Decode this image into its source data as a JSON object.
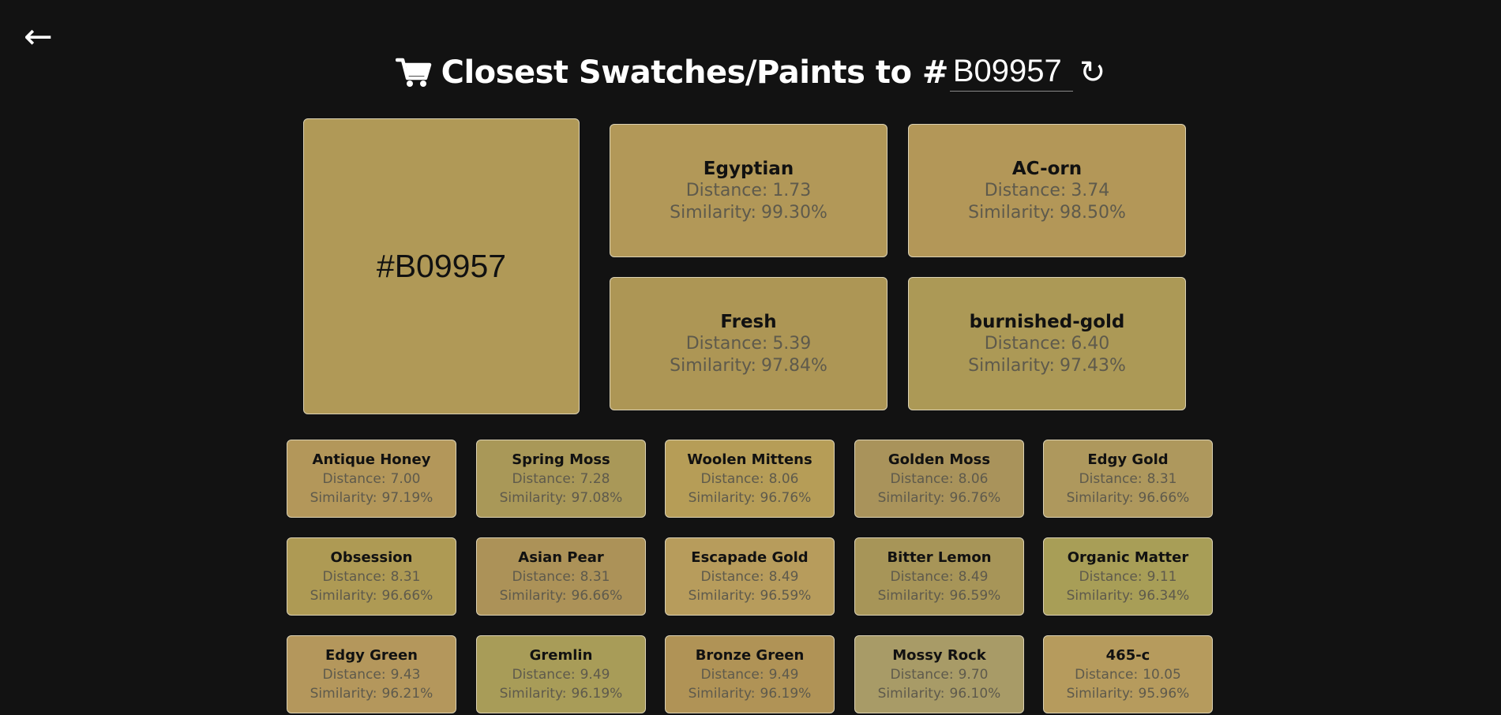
{
  "nav": {
    "back_glyph": "←"
  },
  "header": {
    "cart_icon": "cart-icon",
    "title": "Closest Swatches/Paints to #",
    "hex_value": "B09957",
    "refresh_glyph": "↻"
  },
  "main_swatch": {
    "label": "#B09957",
    "color": "#B09957"
  },
  "labels": {
    "distance": "Distance:",
    "similarity": "Similarity:"
  },
  "top_matches": [
    {
      "name": "Egyptian",
      "distance": "1.73",
      "similarity": "99.30%",
      "color": "#B29858"
    },
    {
      "name": "AC-orn",
      "distance": "3.74",
      "similarity": "98.50%",
      "color": "#B39758"
    },
    {
      "name": "Fresh",
      "distance": "5.39",
      "similarity": "97.84%",
      "color": "#AD9655"
    },
    {
      "name": "burnished-gold",
      "distance": "6.40",
      "similarity": "97.43%",
      "color": "#AC9956"
    }
  ],
  "matches": [
    {
      "name": "Antique Honey",
      "distance": "7.00",
      "similarity": "97.19%",
      "color": "#B3975A"
    },
    {
      "name": "Spring Moss",
      "distance": "7.28",
      "similarity": "97.08%",
      "color": "#A99858"
    },
    {
      "name": "Woolen Mittens",
      "distance": "8.06",
      "similarity": "96.76%",
      "color": "#B69D57"
    },
    {
      "name": "Golden Moss",
      "distance": "8.06",
      "similarity": "96.76%",
      "color": "#A9935B"
    },
    {
      "name": "Edgy Gold",
      "distance": "8.31",
      "similarity": "96.66%",
      "color": "#AE985D"
    },
    {
      "name": "Obsession",
      "distance": "8.31",
      "similarity": "96.66%",
      "color": "#AE9A54"
    },
    {
      "name": "Asian Pear",
      "distance": "8.31",
      "similarity": "96.66%",
      "color": "#AC9258"
    },
    {
      "name": "Escapade Gold",
      "distance": "8.49",
      "similarity": "96.59%",
      "color": "#B79C5C"
    },
    {
      "name": "Bitter Lemon",
      "distance": "8.49",
      "similarity": "96.59%",
      "color": "#A79558"
    },
    {
      "name": "Organic Matter",
      "distance": "9.11",
      "similarity": "96.34%",
      "color": "#A89E57"
    },
    {
      "name": "Edgy Green",
      "distance": "9.43",
      "similarity": "96.21%",
      "color": "#B4975C"
    },
    {
      "name": "Gremlin",
      "distance": "9.49",
      "similarity": "96.19%",
      "color": "#A89C58"
    },
    {
      "name": "Bronze Green",
      "distance": "9.49",
      "similarity": "96.19%",
      "color": "#B09356"
    },
    {
      "name": "Mossy Rock",
      "distance": "9.70",
      "similarity": "96.10%",
      "color": "#A89B67"
    },
    {
      "name": "465-c",
      "distance": "10.05",
      "similarity": "95.96%",
      "color": "#B69B5D"
    }
  ]
}
